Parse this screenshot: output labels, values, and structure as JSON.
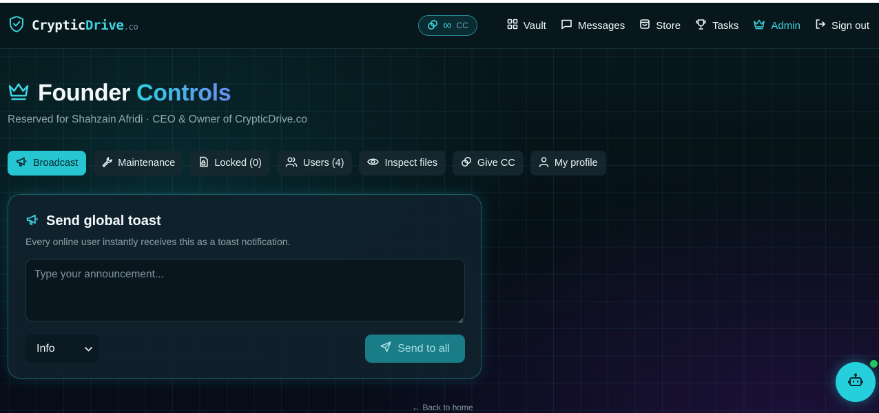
{
  "brand": {
    "name_part1": "Cryptic",
    "name_part2": "Drive",
    "tld": ".co"
  },
  "nav": {
    "credits": {
      "value": "∞",
      "unit": "CC"
    },
    "items": [
      {
        "label": "Vault",
        "icon": "grid-icon"
      },
      {
        "label": "Messages",
        "icon": "message-icon"
      },
      {
        "label": "Store",
        "icon": "bag-icon"
      },
      {
        "label": "Tasks",
        "icon": "trophy-icon"
      },
      {
        "label": "Admin",
        "icon": "crown-icon",
        "active": true
      },
      {
        "label": "Sign out",
        "icon": "sign-out-icon"
      }
    ]
  },
  "page": {
    "title_main": "Founder",
    "title_accent": "Controls",
    "subtitle": "Reserved for Shahzain Afridi · CEO & Owner of CrypticDrive.co"
  },
  "tabs": [
    {
      "label": "Broadcast",
      "icon": "megaphone-icon",
      "active": true
    },
    {
      "label": "Maintenance",
      "icon": "wrench-icon"
    },
    {
      "label": "Locked (0)",
      "icon": "lock-file-icon"
    },
    {
      "label": "Users (4)",
      "icon": "users-icon"
    },
    {
      "label": "Inspect files",
      "icon": "eye-icon"
    },
    {
      "label": "Give CC",
      "icon": "coins-icon"
    },
    {
      "label": "My profile",
      "icon": "user-icon"
    }
  ],
  "broadcast": {
    "title": "Send global toast",
    "description": "Every online user instantly receives this as a toast notification.",
    "placeholder": "Type your announcement...",
    "level": "Info",
    "send_label": "Send to all"
  },
  "footer": {
    "back_label": "← Back to home"
  },
  "colors": {
    "accent": "#25c6d2",
    "background": "#061418",
    "card": "#10222c",
    "online_dot": "#22c55e"
  }
}
